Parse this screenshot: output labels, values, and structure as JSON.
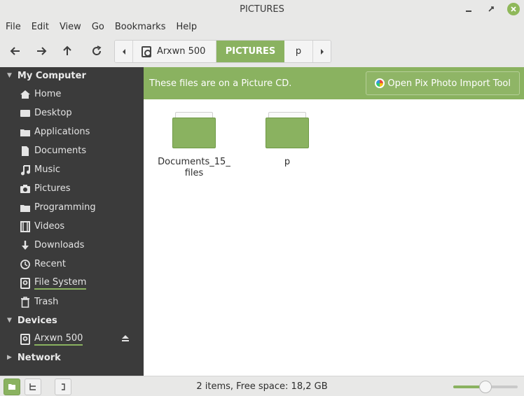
{
  "window": {
    "title": "PICTURES"
  },
  "menu": [
    "File",
    "Edit",
    "View",
    "Go",
    "Bookmarks",
    "Help"
  ],
  "breadcrumb": {
    "items": [
      "Arxwn 500",
      "PICTURES",
      "p"
    ],
    "active_index": 1
  },
  "sidebar": {
    "sections": {
      "my_computer": "My Computer",
      "devices": "Devices",
      "network": "Network"
    },
    "places": [
      {
        "label": "Home",
        "icon": "home-icon"
      },
      {
        "label": "Desktop",
        "icon": "desktop-icon"
      },
      {
        "label": "Applications",
        "icon": "folder-icon"
      },
      {
        "label": "Documents",
        "icon": "document-icon"
      },
      {
        "label": "Music",
        "icon": "music-icon"
      },
      {
        "label": "Pictures",
        "icon": "camera-icon"
      },
      {
        "label": "Programming",
        "icon": "folder-icon"
      },
      {
        "label": "Videos",
        "icon": "film-icon"
      },
      {
        "label": "Downloads",
        "icon": "download-icon"
      },
      {
        "label": "Recent",
        "icon": "history-icon"
      },
      {
        "label": "File System",
        "icon": "disk-icon"
      },
      {
        "label": "Trash",
        "icon": "trash-icon"
      }
    ],
    "devices": [
      {
        "label": "Arxwn 500",
        "icon": "disk-icon"
      }
    ]
  },
  "infobar": {
    "message": "These files are on a Picture CD.",
    "button_label": "Open Pix Photo Import Tool"
  },
  "files": [
    {
      "name": "Documents_15_files",
      "line1": "Documents_15_",
      "line2": "files",
      "icon": "folder-icon"
    },
    {
      "name": "p",
      "line1": "p",
      "line2": "",
      "icon": "folder-icon"
    }
  ],
  "status": {
    "text": "2 items, Free space: 18,2 GB",
    "zoom_fraction": 0.5
  },
  "colors": {
    "accent": "#8ab260",
    "sidebar_bg": "#3b3b3b"
  }
}
